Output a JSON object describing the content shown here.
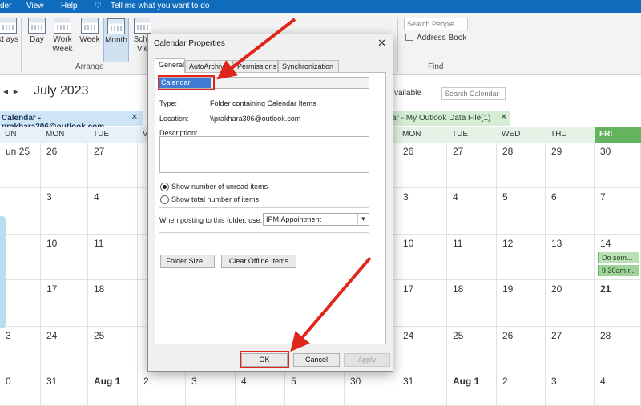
{
  "topbar": {
    "left_cut": "der",
    "view": "View",
    "help": "Help",
    "tell_me": "Tell me what you want to do"
  },
  "ribbon": {
    "buttons": [
      {
        "label": "xt ays"
      },
      {
        "label": "Day"
      },
      {
        "label": "Work Week"
      },
      {
        "label": "Week"
      },
      {
        "label": "Month"
      },
      {
        "label": "Sche Vie"
      }
    ],
    "arrange_label": "Arrange",
    "search_people_placeholder": "Search People",
    "address_book": "Address Book",
    "find_label": "Find"
  },
  "calendar": {
    "month_title": "July 2023",
    "available_label": "vailable",
    "search_placeholder": "Search Calendar",
    "tab_left": "Calendar - prakhara306@outlook.com",
    "tab_right": "ar - My Outlook Data File(1)",
    "close_glyph": "✕",
    "days_left": [
      "UN",
      "MON",
      "TUE",
      "V"
    ],
    "days_right": [
      "",
      "MON",
      "TUE",
      "WED",
      "THU",
      "FRI"
    ],
    "rows_left": [
      [
        "un 25",
        "26",
        "27",
        ""
      ],
      [
        "",
        "3",
        "4",
        ""
      ],
      [
        "",
        "10",
        "11",
        ""
      ],
      [
        "",
        "17",
        "18",
        ""
      ],
      [
        "3",
        "24",
        "25",
        ""
      ],
      [
        "0",
        "31",
        "Aug 1",
        "2"
      ]
    ],
    "rows_right": [
      [
        "",
        "26",
        "27",
        "28",
        "29",
        "30"
      ],
      [
        "",
        "3",
        "4",
        "5",
        "6",
        "7"
      ],
      [
        "",
        "10",
        "11",
        "12",
        "13",
        "14"
      ],
      [
        "",
        "17",
        "18",
        "19",
        "20",
        "21"
      ],
      [
        "",
        "24",
        "25",
        "26",
        "27",
        "28"
      ],
      [
        "30",
        "31",
        "Aug 1",
        "2",
        "3",
        "4"
      ]
    ],
    "mid_row_last": [
      "3",
      "4",
      "5"
    ],
    "appointments": [
      "Do som...",
      "9:30am r..."
    ]
  },
  "dialog": {
    "title": "Calendar Properties",
    "close": "✕",
    "tabs": [
      "General",
      "AutoArchive",
      "Permissions",
      "Synchronization"
    ],
    "name_value": "Calendar",
    "type_label": "Type:",
    "type_value": "Folder containing Calendar Items",
    "location_label": "Location:",
    "location_value": "\\\\prakhara306@outlook.com",
    "description_label": "Description:",
    "radio_unread": "Show number of unread items",
    "radio_total": "Show total number of items",
    "posting_label": "When posting to this folder, use:",
    "posting_value": "IPM.Appointment",
    "folder_size_btn": "Folder Size...",
    "clear_offline_btn": "Clear Offline Items",
    "ok": "OK",
    "cancel": "Cancel",
    "apply": "Apply"
  },
  "colors": {
    "accent_red": "#e0251b",
    "outlook_blue": "#0f6cbd",
    "green": "#63b35f"
  }
}
